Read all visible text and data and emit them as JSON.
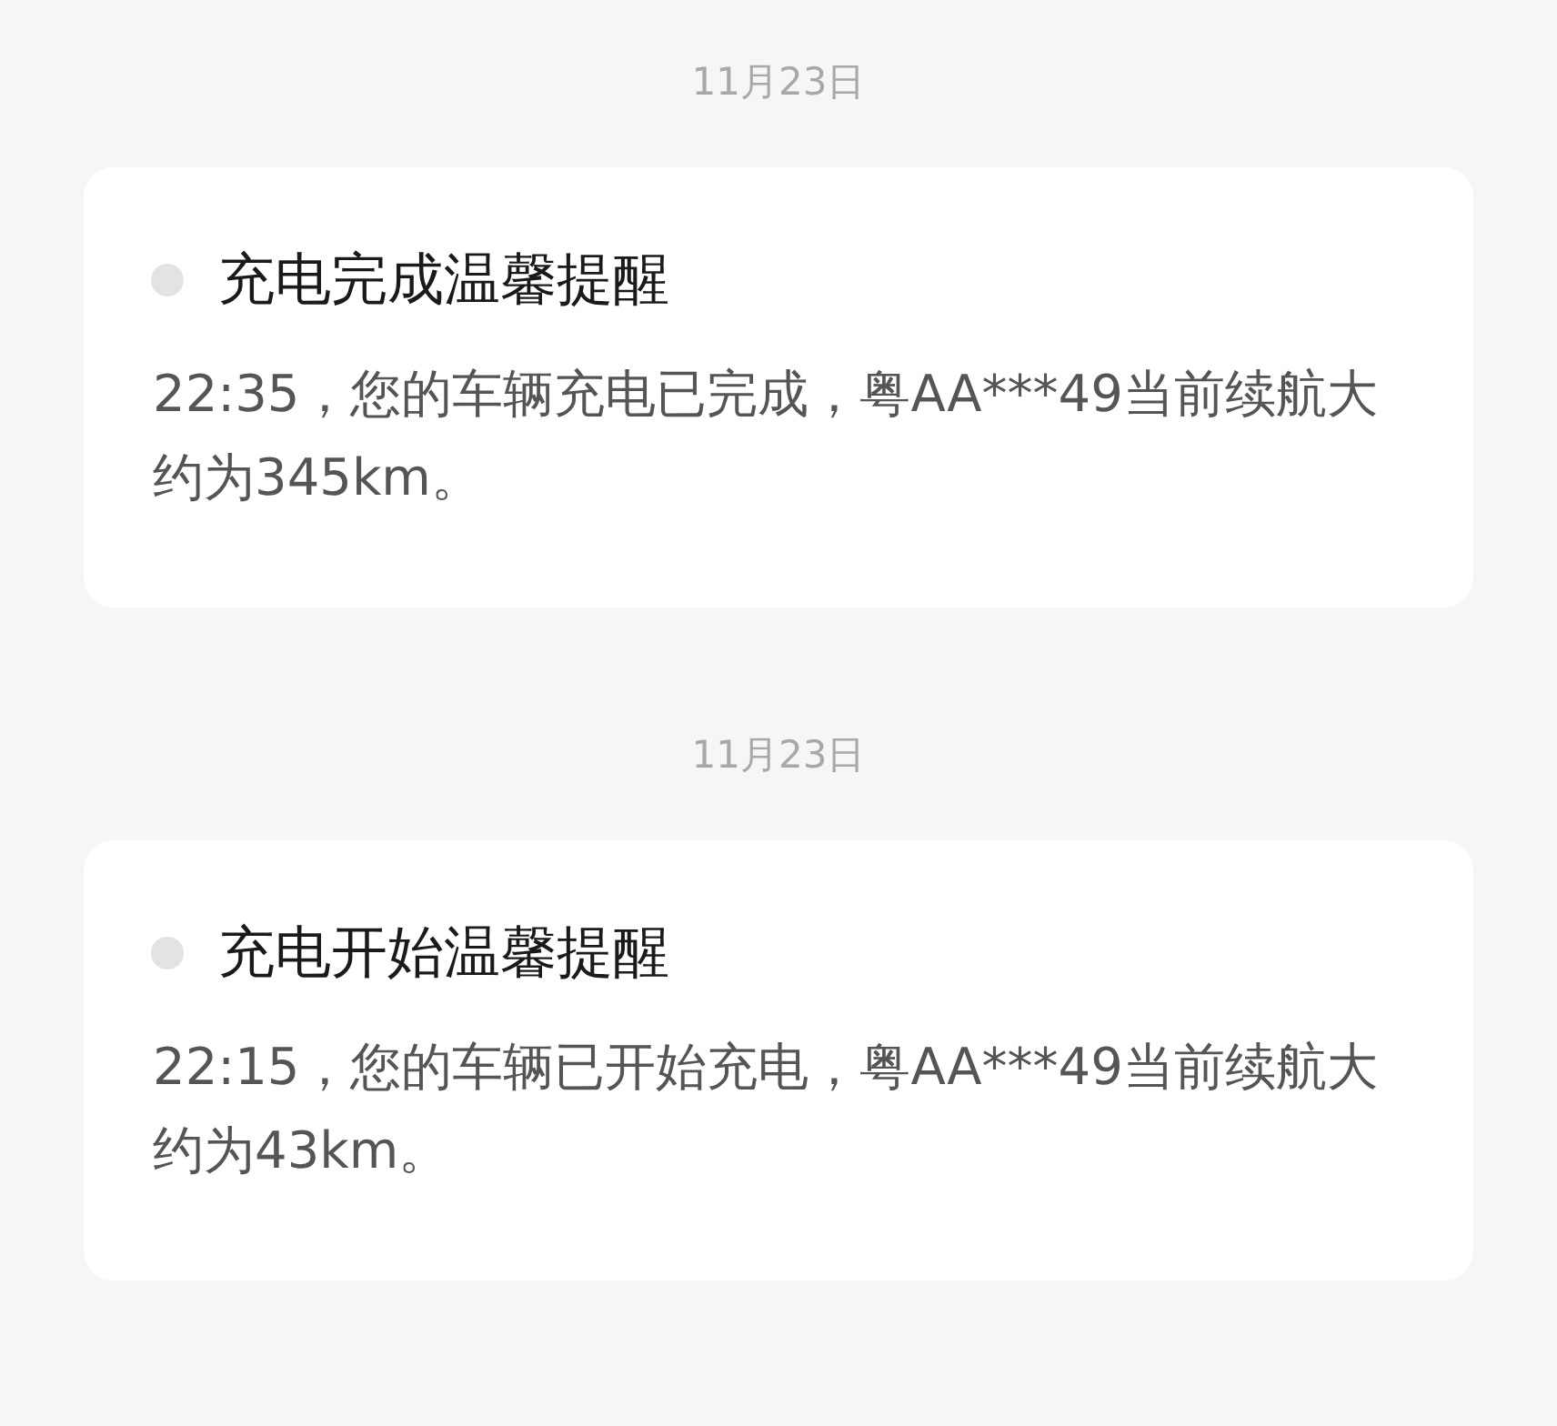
{
  "messages": [
    {
      "date": "11月23日",
      "title": "充电完成温馨提醒",
      "body": "22:35，您的车辆充电已完成，粤AA***49当前续航大约为345km。"
    },
    {
      "date": "11月23日",
      "title": "充电开始温馨提醒",
      "body": "22:15，您的车辆已开始充电，粤AA***49当前续航大约为43km。"
    }
  ]
}
